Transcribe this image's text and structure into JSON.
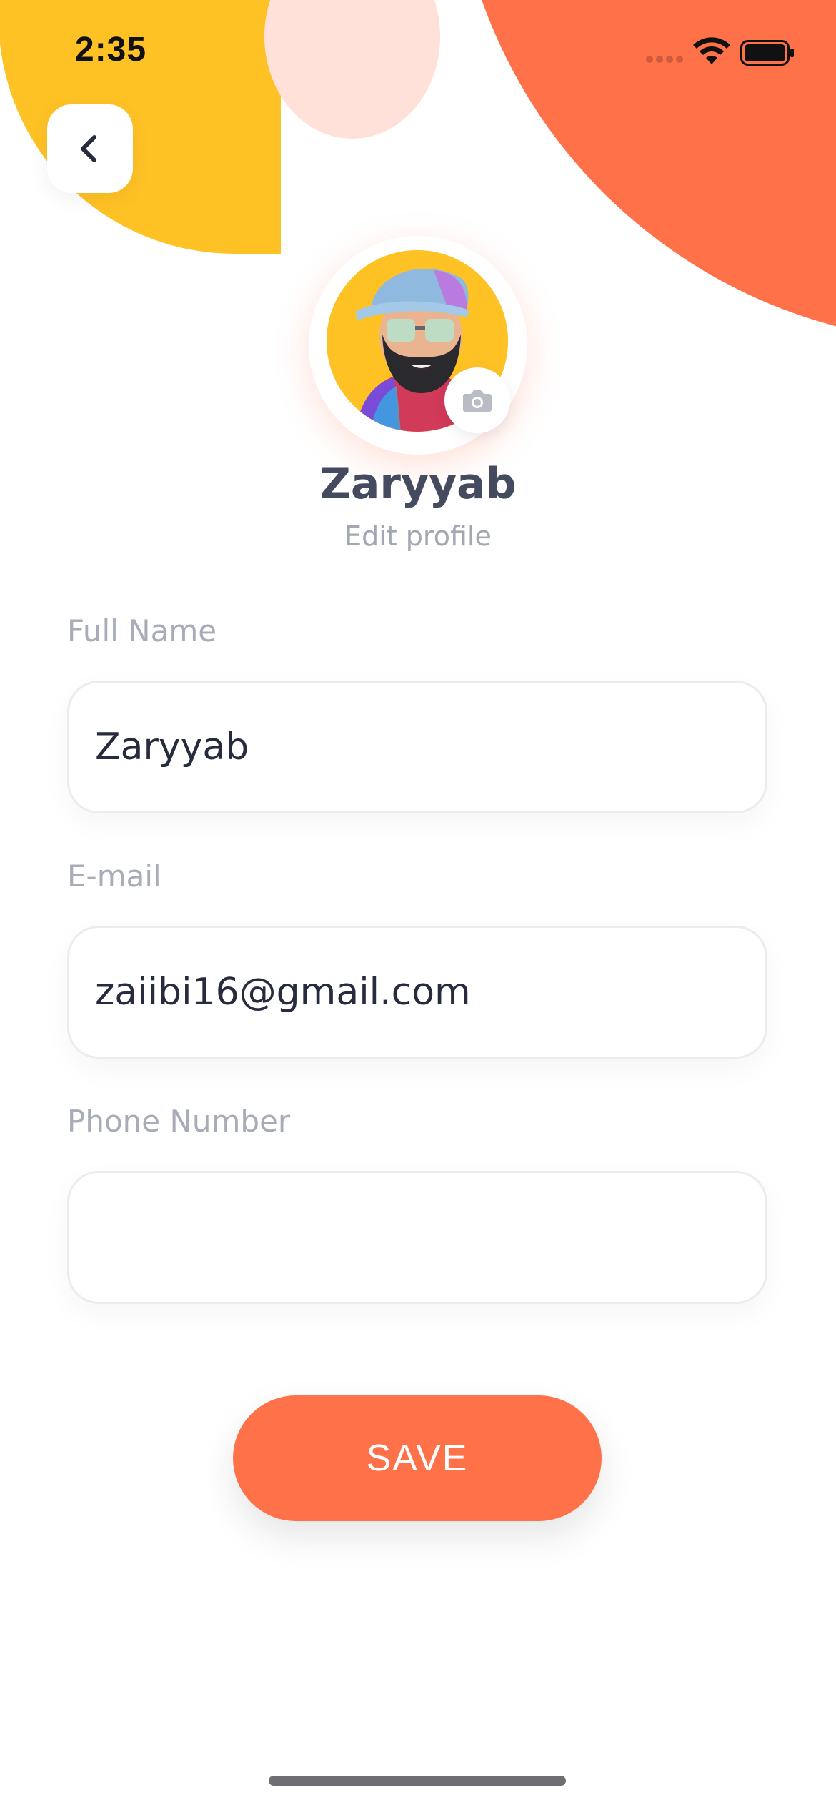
{
  "status_bar": {
    "time": "2:35",
    "icons": [
      "cellular-signal-icon",
      "wifi-icon",
      "battery-icon"
    ]
  },
  "header": {
    "back_icon": "chevron-left-icon"
  },
  "profile": {
    "name": "Zaryyab",
    "subtitle": "Edit profile",
    "camera_icon": "camera-icon"
  },
  "form": {
    "full_name": {
      "label": "Full Name",
      "value": "Zaryyab",
      "placeholder": ""
    },
    "email": {
      "label": "E-mail",
      "value": "zaiibi16@gmail.com",
      "placeholder": ""
    },
    "phone": {
      "label": "Phone Number",
      "value": "",
      "placeholder": ""
    }
  },
  "actions": {
    "save_label": "SAVE"
  },
  "colors": {
    "accent_orange": "#FF7149",
    "accent_yellow": "#FFC225",
    "accent_pink": "#FFE1D9",
    "title_text": "#454B5E",
    "muted_text": "#A3A7B4",
    "input_text": "#262B3D"
  }
}
